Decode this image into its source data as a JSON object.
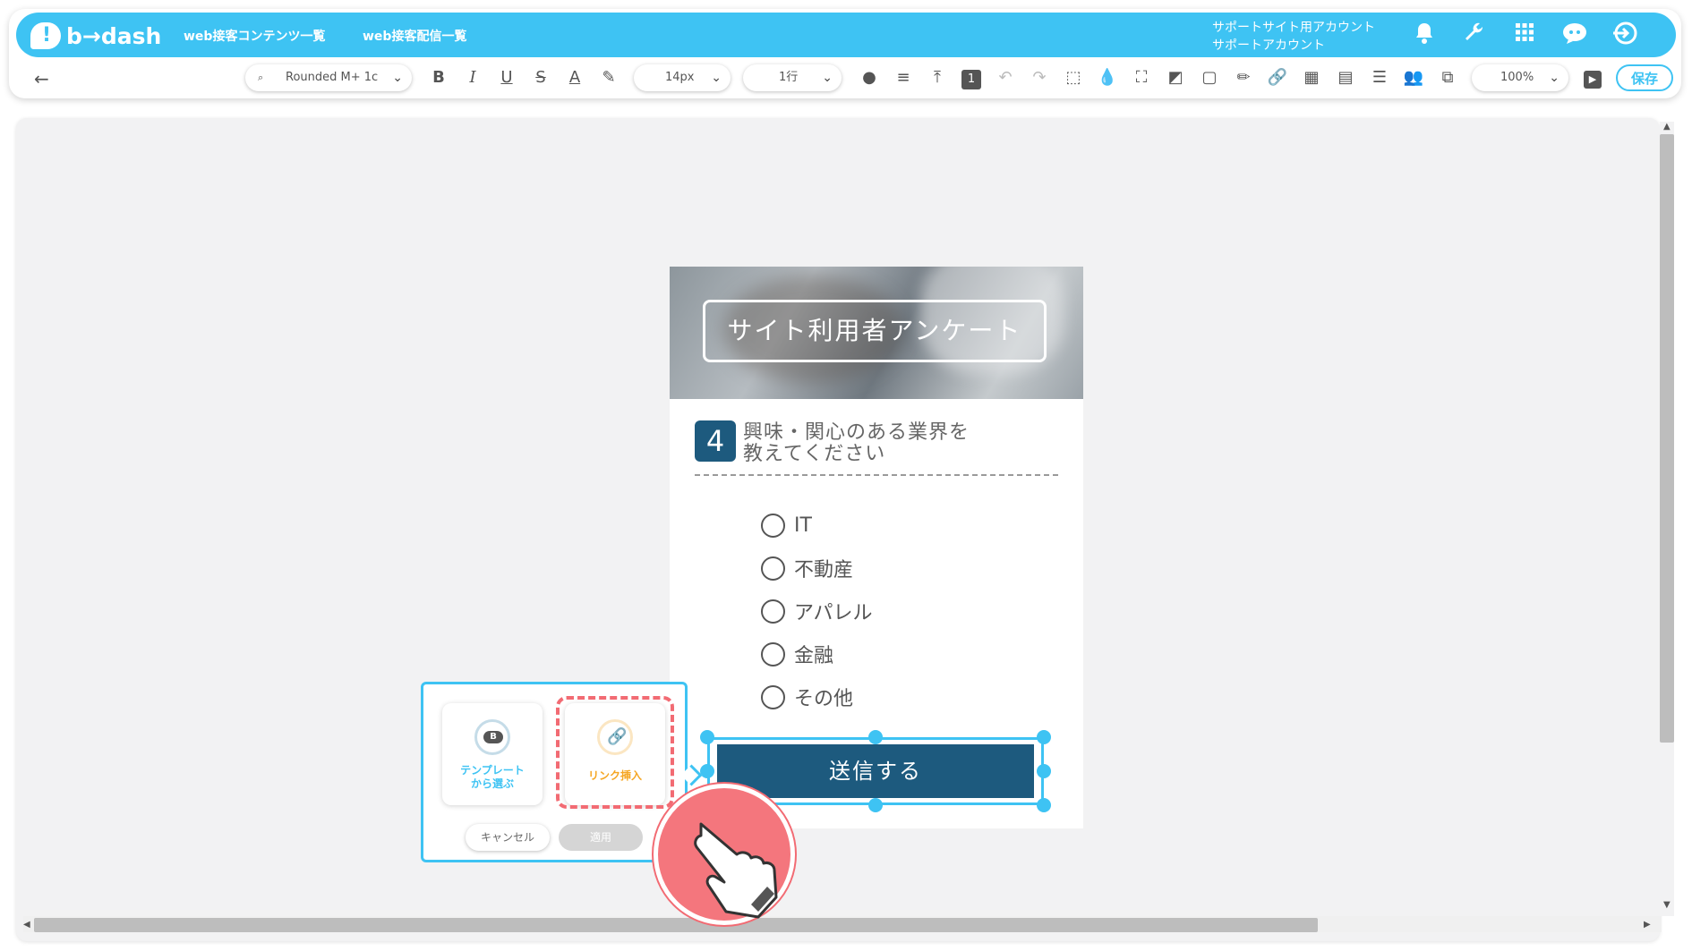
{
  "header": {
    "logo_text": "b→dash",
    "nav": [
      "web接客コンテンツ一覧",
      "web接客配信一覧"
    ],
    "account_line1": "サポートサイト用アカウント",
    "account_line2": "サポートアカウント",
    "icons": [
      "bell-icon",
      "wrench-icon",
      "apps-grid-icon",
      "chat-bot-icon",
      "logout-icon"
    ]
  },
  "toolbar": {
    "font_family": "Rounded M+ 1c",
    "font_size": "14px",
    "line_height": "1行",
    "zoom": "100%",
    "save_label": "保存",
    "layer_badge": "1"
  },
  "survey": {
    "title": "サイト利用者アンケート",
    "question_number": "4",
    "question_line1": "興味・関心のある業界を",
    "question_line2": "教えてください",
    "options": [
      "IT",
      "不動産",
      "アパレル",
      "金融",
      "その他"
    ],
    "submit_label": "送信する"
  },
  "popup": {
    "template_badge": "B",
    "template_label_line1": "テンプレート",
    "template_label_line2": "から選ぶ",
    "link_label": "リンク挿入",
    "cancel_label": "キャンセル",
    "apply_label": "適用"
  },
  "colors": {
    "brand": "#3ec3f3",
    "primary_dark": "#1d5a7e",
    "highlight": "#f26b73",
    "link_orange": "#f5a623"
  }
}
